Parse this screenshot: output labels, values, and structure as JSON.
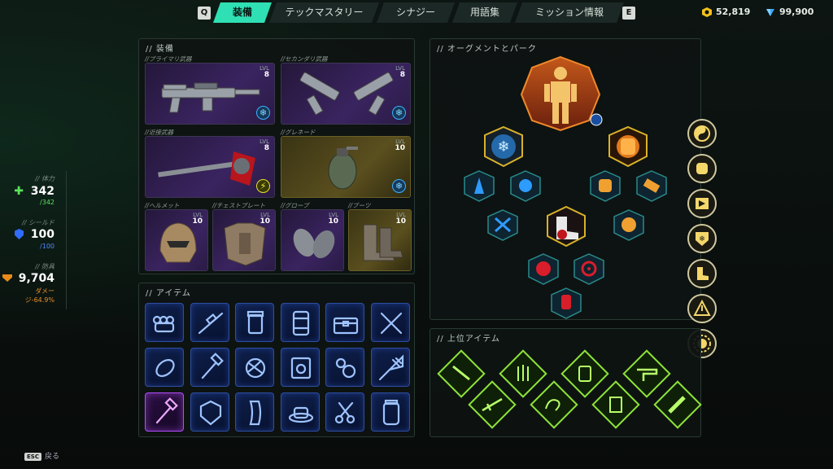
{
  "topbar": {
    "left_key": "Q",
    "right_key": "E",
    "tabs": [
      "装備",
      "テックマスタリー",
      "シナジー",
      "用語集",
      "ミッション情報"
    ],
    "active_tab": 0,
    "currency_1": "52,819",
    "currency_2": "99,900"
  },
  "stats": {
    "health": {
      "label": "// 体力",
      "value": "342",
      "max": "/342"
    },
    "shield": {
      "label": "// シールド",
      "value": "100",
      "max": "/100"
    },
    "armor": {
      "label": "// 防具",
      "value": "9,704",
      "sub1": "ダメー",
      "sub2": "ジ-64.9%"
    }
  },
  "equipment": {
    "title": "// 装備",
    "lvl_label": "LVL",
    "slots": [
      {
        "label": "//プライマリ武器",
        "level": "8",
        "badge": "snowflake",
        "icon": "assault-rifle-icon"
      },
      {
        "label": "//セカンダリ武器",
        "level": "8",
        "badge": "snowflake",
        "icon": "dual-pistols-icon"
      },
      {
        "label": "//近接武器",
        "level": "8",
        "badge": "lightning",
        "icon": "melee-axe-icon"
      },
      {
        "label": "//グレネード",
        "level": "10",
        "badge": "snowflake",
        "icon": "grenade-icon"
      },
      {
        "label": "//ヘルメット",
        "level": "10",
        "icon": "helmet-icon"
      },
      {
        "label": "//チェストプレート",
        "level": "10",
        "icon": "chestplate-icon"
      },
      {
        "label": "//グローブ",
        "level": "10",
        "icon": "gloves-icon"
      },
      {
        "label": "//ブーツ",
        "level": "10",
        "icon": "boots-icon"
      }
    ]
  },
  "items": {
    "title": "// アイテム",
    "icons": [
      "brass-knuckles-icon",
      "scope-rifle-icon",
      "pill-bottle-icon",
      "canister-icon",
      "treasure-chest-icon",
      "crossed-batons-icon",
      "rope-coil-icon",
      "hammer-icon",
      "yarn-ball-icon",
      "biohazard-box-icon",
      "chain-icon",
      "net-icon",
      "small-hammer-icon",
      "shield-plate-icon",
      "magazine-icon",
      "coffee-cup-icon",
      "scissors-icon",
      "jar-icon"
    ],
    "selected": 12
  },
  "augments": {
    "title": "// オーグメントとパーク",
    "icons": [
      "robot-armor-icon",
      "snowflake-icon",
      "fist-icon",
      "ice-crystal-icon",
      "ice-burst-icon",
      "fist-small-icon",
      "claw-icon",
      "shatter-icon",
      "muscle-icon",
      "boot-kick-icon",
      "demon-icon",
      "target-icon",
      "hand-cursor-icon"
    ]
  },
  "side_perks": [
    "yin-yang-icon",
    "punch-icon",
    "flag-icon",
    "snowflake-shield-icon",
    "boot-icon",
    "warning-icon",
    "sun-icon"
  ],
  "top_items": {
    "title": "// 上位アイテム",
    "icons": [
      "knife-icon",
      "hand-bones-icon",
      "pill-jar-icon",
      "pistol-icon",
      "rifle-icon",
      "cobra-icon",
      "juice-box-icon",
      "flashlight-icon"
    ]
  },
  "footer": {
    "key": "ESC",
    "label": "戻る"
  },
  "colors": {
    "accent": "#2fe0b4",
    "gold": "#d9b22a",
    "item_blue": "#4f8bff",
    "augment_orange": "#e07a1a"
  }
}
